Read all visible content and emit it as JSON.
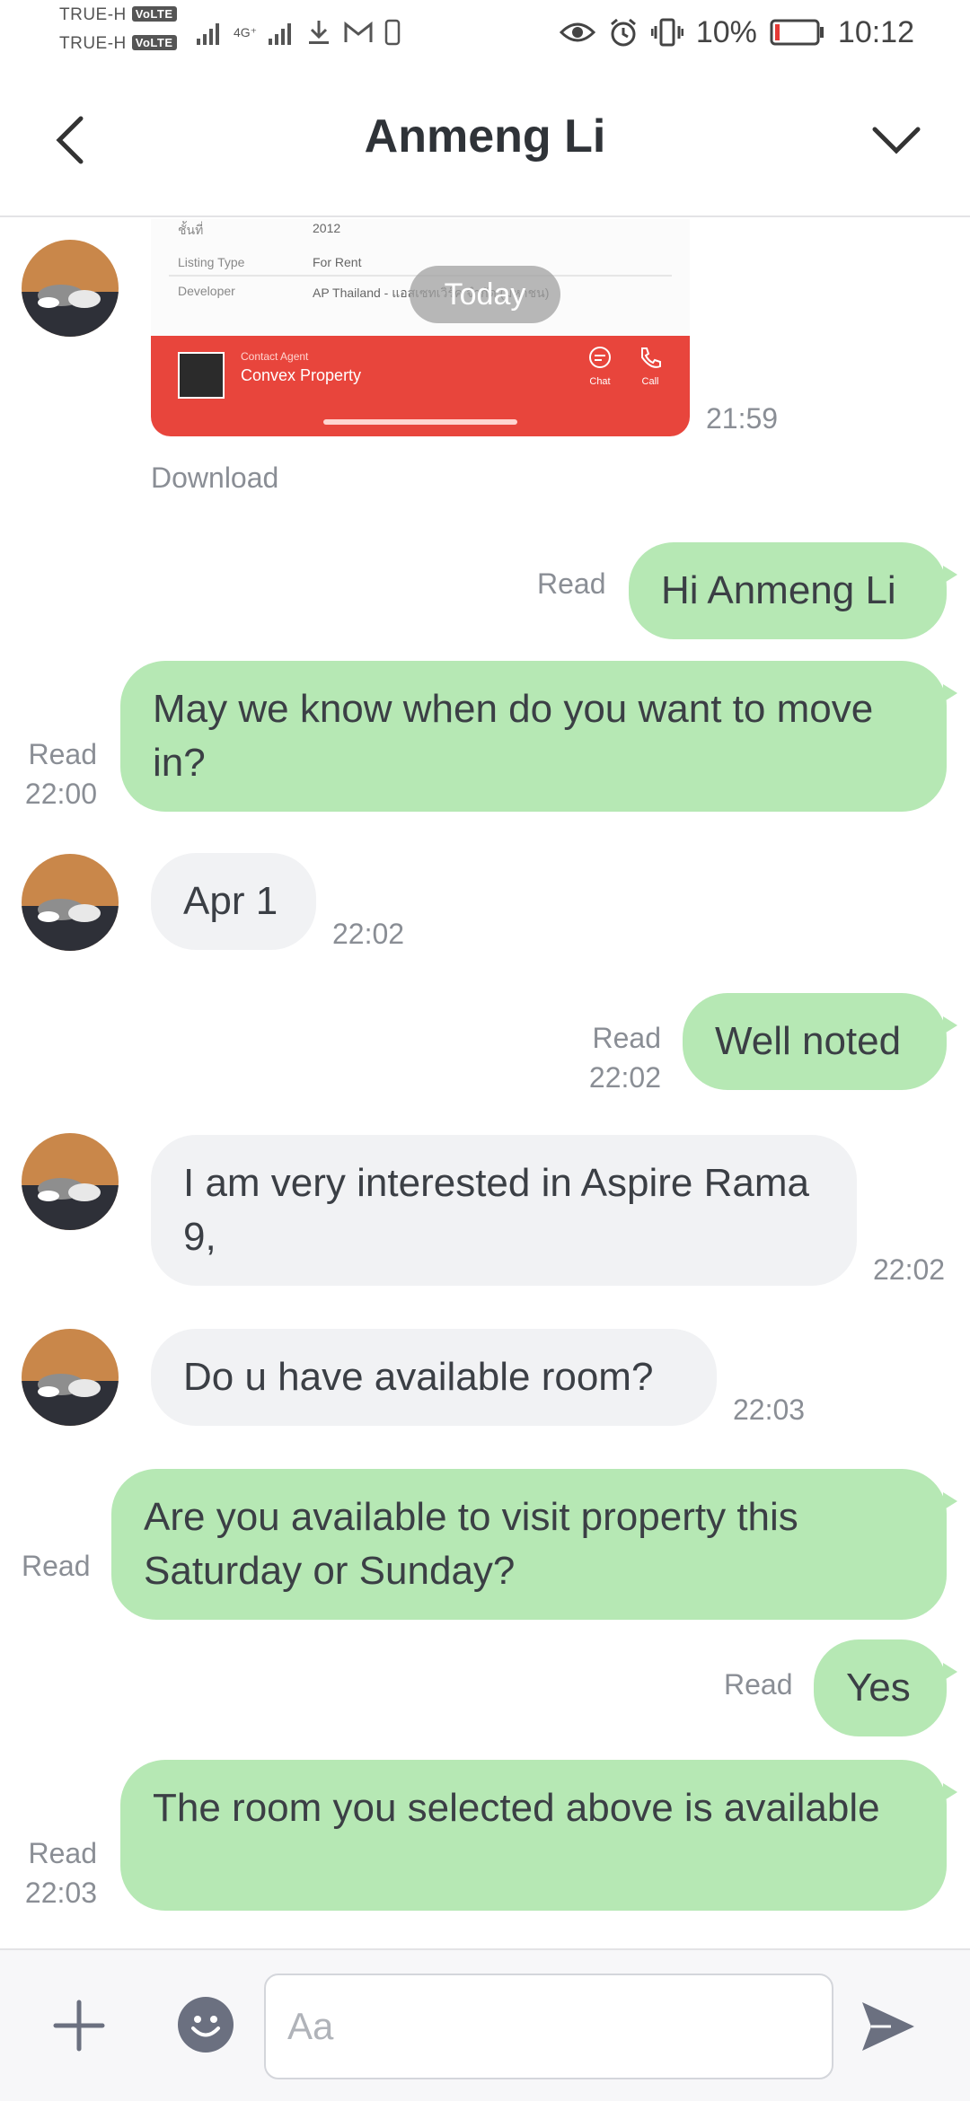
{
  "status_bar": {
    "carrier1": "TRUE-H",
    "carrier2": "TRUE-H",
    "volte": "VoLTE",
    "network": "4G⁺",
    "battery": "10%",
    "time": "10:12",
    "battery_level": 0.1,
    "battery_color": "#e53935"
  },
  "header": {
    "title": "Anmeng Li"
  },
  "chat": {
    "date_pill": "Today",
    "image_time": "21:59",
    "download_label": "Download",
    "image_card": {
      "row1_label": "ชั้นที่",
      "row1_value": "2012",
      "row2_label": "Listing Type",
      "row2_value": "For Rent",
      "row3_label": "Developer",
      "row3_value": "AP Thailand - แอสเซทเวิร์ค จำกัด (มหาชน)",
      "banner_small": "Contact Agent",
      "banner_title": "Convex Property",
      "chat_label": "Chat",
      "call_label": "Call"
    },
    "messages": [
      {
        "dir": "out",
        "text": "Hi Anmeng Li",
        "read": "Read",
        "time": ""
      },
      {
        "dir": "out",
        "text": "May we know when do you want to move in?",
        "read": "Read",
        "time": "22:00"
      },
      {
        "dir": "in",
        "text": "Apr 1",
        "time": "22:02"
      },
      {
        "dir": "out",
        "text": "Well noted",
        "read": "Read",
        "time": "22:02"
      },
      {
        "dir": "in",
        "text": "I am very interested in Aspire Rama 9,",
        "time": "22:02"
      },
      {
        "dir": "in",
        "text": "Do u have available room?",
        "time": "22:03"
      },
      {
        "dir": "out",
        "text": "Are you available to visit property this Saturday or Sunday?",
        "read": "Read",
        "time": ""
      },
      {
        "dir": "out",
        "text": "Yes",
        "read": "Read",
        "time": ""
      },
      {
        "dir": "out",
        "text": "The room you selected above is available",
        "read": "Read",
        "time": "22:03"
      }
    ]
  },
  "composer": {
    "placeholder": "Aa"
  },
  "colors": {
    "outgoing_bubble": "#b6e8b4",
    "incoming_bubble": "#f1f2f4",
    "banner_red": "#e8453c",
    "icon_gray": "#6b7080"
  }
}
